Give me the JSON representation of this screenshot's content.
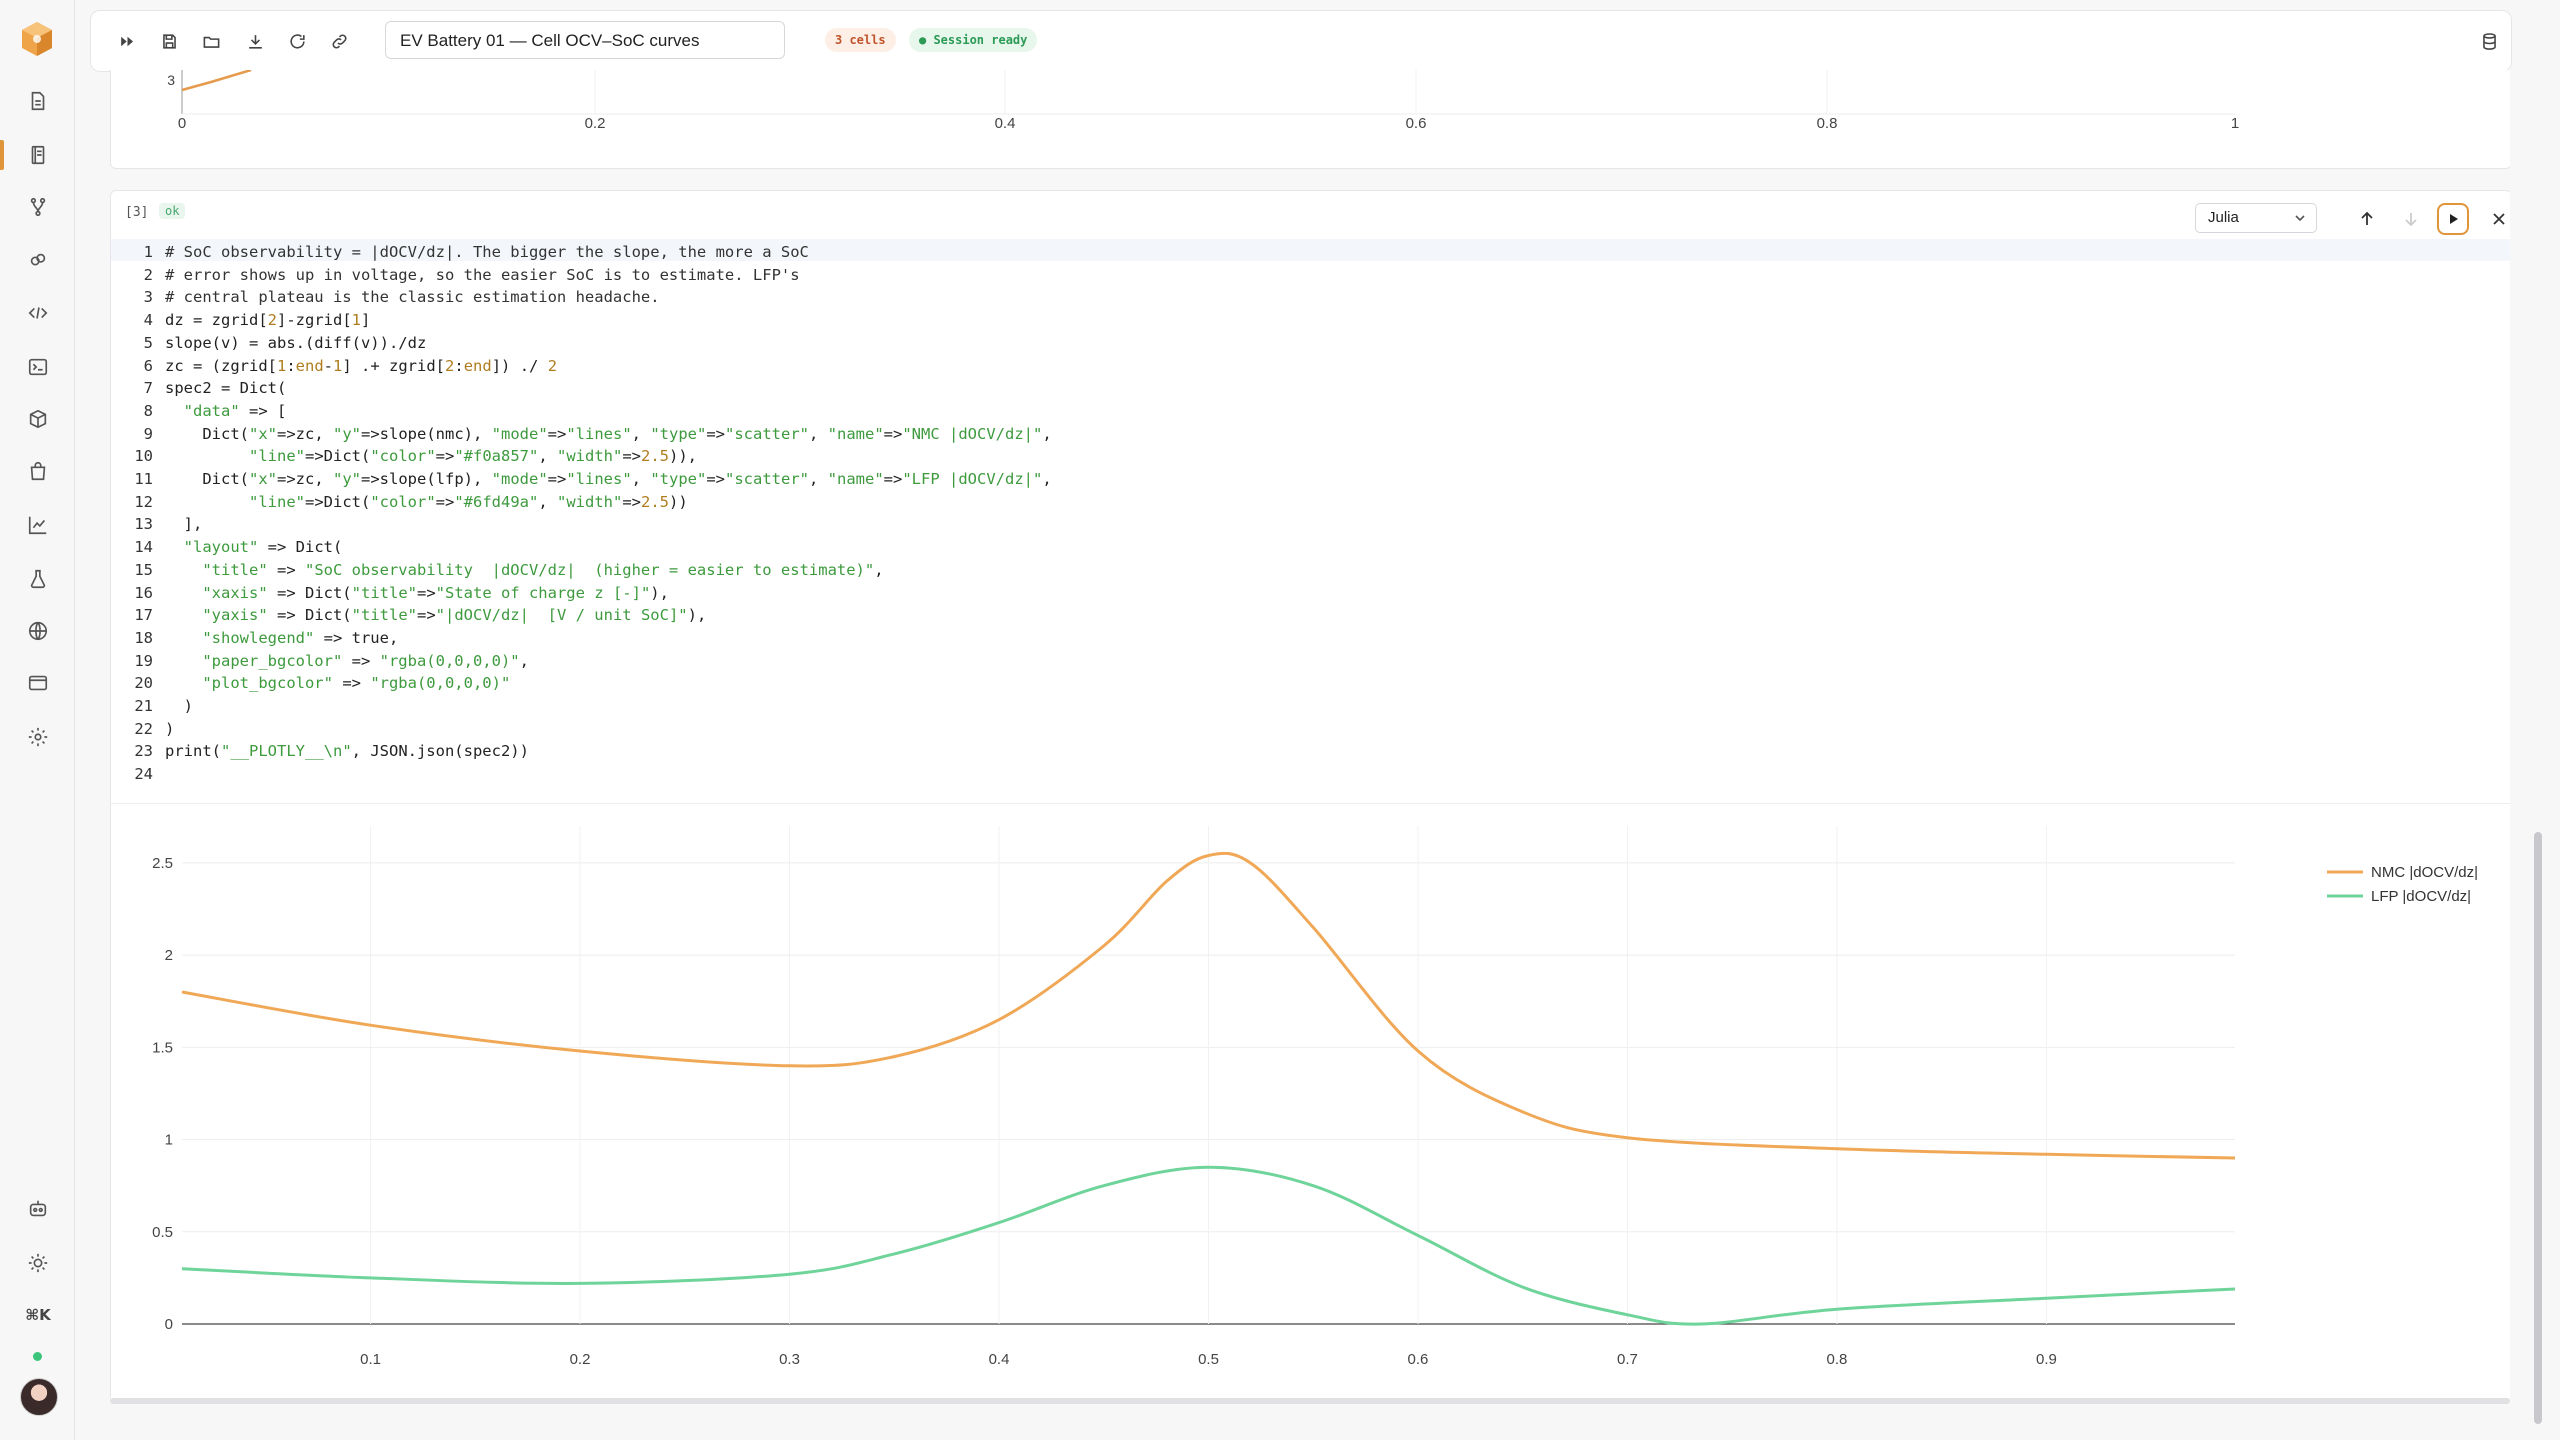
{
  "toolbar": {
    "notebook_title": "EV Battery 01 — Cell OCV–SoC curves",
    "cells_badge": "3 cells",
    "session_badge": "● Session ready"
  },
  "prev_cell": {
    "x_ticks": [
      "0",
      "0.2",
      "0.4",
      "0.6",
      "0.8",
      "1"
    ],
    "y_tick": "3"
  },
  "cell": {
    "exec_count": "[3]",
    "status": "ok",
    "language": "Julia"
  },
  "code_lines": [
    "# SoC observability = |dOCV/dz|. The bigger the slope, the more a SoC",
    "# error shows up in voltage, so the easier SoC is to estimate. LFP's",
    "# central plateau is the classic estimation headache.",
    "dz = zgrid[2]-zgrid[1]",
    "slope(v) = abs.(diff(v))./dz",
    "zc = (zgrid[1:end-1] .+ zgrid[2:end]) ./ 2",
    "spec2 = Dict(",
    "  \"data\" => [",
    "    Dict(\"x\"=>zc, \"y\"=>slope(nmc), \"mode\"=>\"lines\", \"type\"=>\"scatter\", \"name\"=>\"NMC |dOCV/dz|\",",
    "         \"line\"=>Dict(\"color\"=>\"#f0a857\", \"width\"=>2.5)),",
    "    Dict(\"x\"=>zc, \"y\"=>slope(lfp), \"mode\"=>\"lines\", \"type\"=>\"scatter\", \"name\"=>\"LFP |dOCV/dz|\",",
    "         \"line\"=>Dict(\"color\"=>\"#6fd49a\", \"width\"=>2.5))",
    "  ],",
    "  \"layout\" => Dict(",
    "    \"title\" => \"SoC observability  |dOCV/dz|  (higher = easier to estimate)\",",
    "    \"xaxis\" => Dict(\"title\"=>\"State of charge z [-]\"),",
    "    \"yaxis\" => Dict(\"title\"=>\"|dOCV/dz|  [V / unit SoC]\"),",
    "    \"showlegend\" => true,",
    "    \"paper_bgcolor\" => \"rgba(0,0,0,0)\",",
    "    \"plot_bgcolor\" => \"rgba(0,0,0,0)\"",
    "  )",
    ")",
    "print(\"__PLOTLY__\\n\", JSON.json(spec2))",
    ""
  ],
  "chart_data": {
    "type": "line",
    "title": "",
    "xlabel": "",
    "ylabel": "",
    "xlim": [
      0.01,
      0.99
    ],
    "ylim": [
      0,
      2.7
    ],
    "x_ticks": [
      0.1,
      0.2,
      0.3,
      0.4,
      0.5,
      0.6,
      0.7,
      0.8,
      0.9
    ],
    "y_ticks": [
      0,
      0.5,
      1,
      1.5,
      2,
      2.5
    ],
    "grid": true,
    "legend_position": "top-right",
    "series": [
      {
        "name": "NMC |dOCV/dz|",
        "color": "#f0a857",
        "x": [
          0.01,
          0.1,
          0.2,
          0.3,
          0.35,
          0.4,
          0.45,
          0.48,
          0.5,
          0.52,
          0.55,
          0.6,
          0.65,
          0.7,
          0.8,
          0.9,
          0.99
        ],
        "y": [
          1.8,
          1.62,
          1.48,
          1.4,
          1.45,
          1.65,
          2.05,
          2.4,
          2.54,
          2.5,
          2.15,
          1.48,
          1.15,
          1.01,
          0.95,
          0.92,
          0.9
        ]
      },
      {
        "name": "LFP |dOCV/dz|",
        "color": "#6fd49a",
        "x": [
          0.01,
          0.1,
          0.2,
          0.3,
          0.35,
          0.4,
          0.45,
          0.5,
          0.55,
          0.6,
          0.65,
          0.7,
          0.735,
          0.8,
          0.9,
          0.99
        ],
        "y": [
          0.3,
          0.25,
          0.22,
          0.27,
          0.38,
          0.55,
          0.75,
          0.85,
          0.75,
          0.48,
          0.2,
          0.05,
          0.0,
          0.08,
          0.14,
          0.19
        ]
      }
    ]
  },
  "colors": {
    "accent": "#e0953a",
    "nmc": "#f0a857",
    "lfp": "#6fd49a"
  }
}
